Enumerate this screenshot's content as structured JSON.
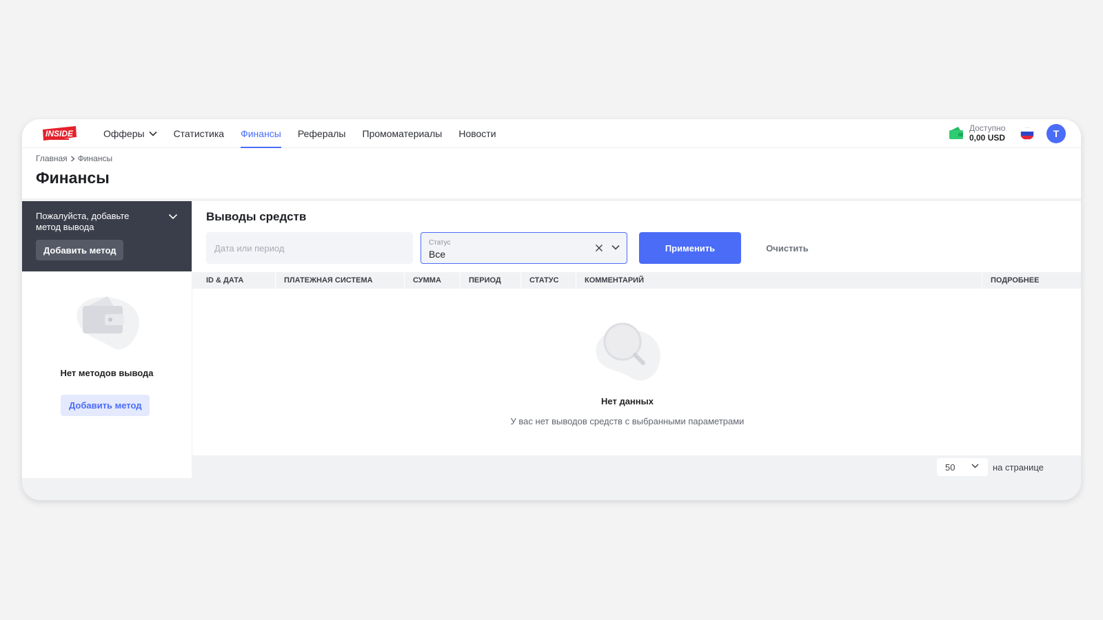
{
  "header": {
    "logo_text": "INSIDE",
    "nav": [
      {
        "label": "Офферы",
        "active": false,
        "has_dropdown": true
      },
      {
        "label": "Статистика",
        "active": false
      },
      {
        "label": "Финансы",
        "active": true
      },
      {
        "label": "Рефералы",
        "active": false
      },
      {
        "label": "Промоматериалы",
        "active": false
      },
      {
        "label": "Новости",
        "active": false
      }
    ],
    "balance_label": "Доступно",
    "balance_value": "0,00 USD",
    "avatar_letter": "T",
    "icons": {
      "wallet": "wallet-icon",
      "flag": "russia-flag-icon",
      "chevron": "chevron-down-icon"
    }
  },
  "breadcrumb": [
    "Главная",
    "Финансы"
  ],
  "page_title": "Финансы",
  "payout_methods": {
    "prompt": "Пожалуйста, добавьте метод вывода",
    "add_button": "Добавить метод",
    "empty_title": "Нет методов вывода",
    "empty_add_button": "Добавить метод"
  },
  "withdrawals": {
    "title": "Выводы средств",
    "date_placeholder": "Дата или период",
    "status_label": "Статус",
    "status_value": "Все",
    "apply_button": "Применить",
    "clear_button": "Очистить",
    "columns": [
      "ID & ДАТА",
      "ПЛАТЕЖНАЯ СИСТЕМА",
      "СУММА",
      "ПЕРИОД",
      "СТАТУС",
      "КОММЕНТАРИЙ",
      "ПОДРОБНЕЕ"
    ],
    "empty_title": "Нет данных",
    "empty_subtitle": "У вас нет выводов средств с выбранными параметрами",
    "per_page_value": "50",
    "per_page_label": "на странице"
  },
  "colors": {
    "accent": "#4a6cf7",
    "dark_panel": "#3a3e4a",
    "wallet_green": "#2ecc71"
  }
}
